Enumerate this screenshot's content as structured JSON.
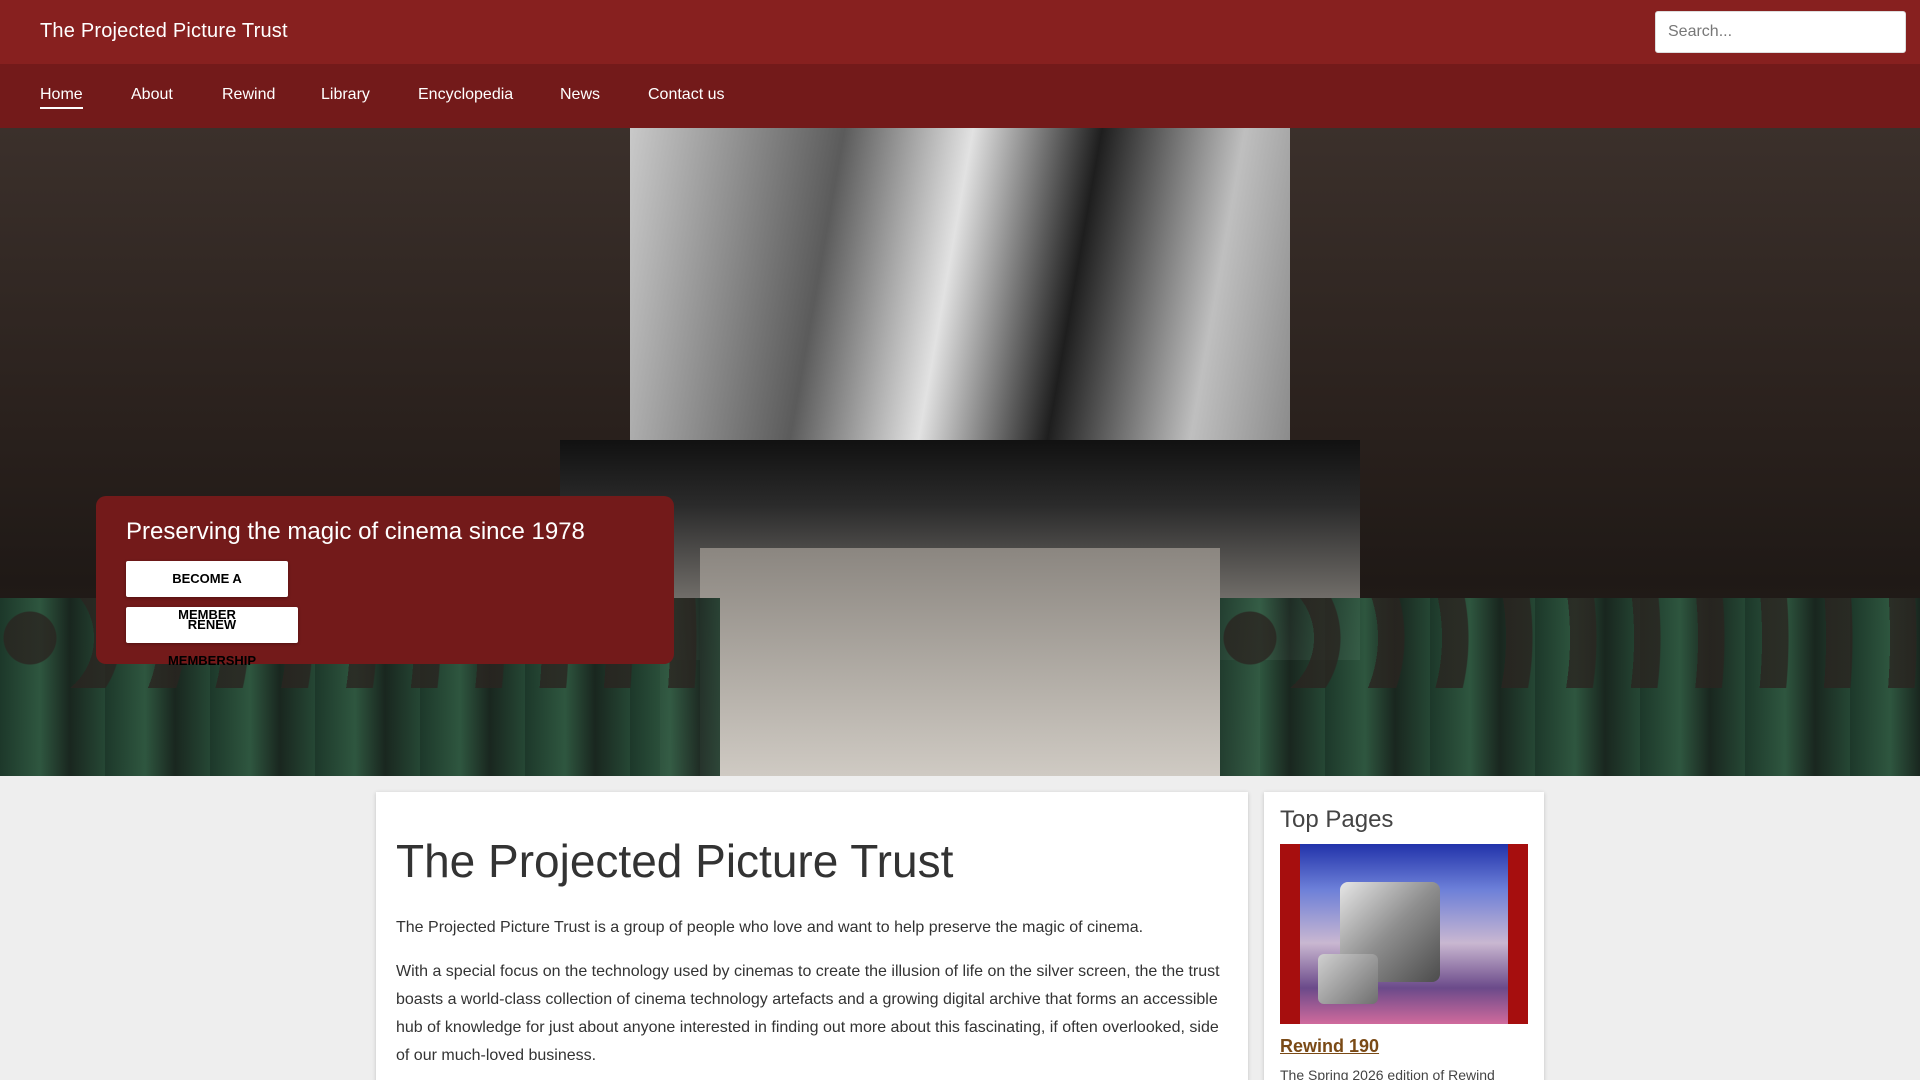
{
  "header": {
    "site_title": "The Projected Picture Trust",
    "search_placeholder": "Search..."
  },
  "nav": {
    "items": [
      {
        "label": "Home",
        "active": true
      },
      {
        "label": "About"
      },
      {
        "label": "Rewind"
      },
      {
        "label": "Library"
      },
      {
        "label": "Encyclopedia"
      },
      {
        "label": "News"
      },
      {
        "label": "Contact us"
      }
    ]
  },
  "hero": {
    "tagline": "Preserving the magic of cinema since 1978",
    "buttons": {
      "member": "BECOME A MEMBER",
      "renew": "RENEW MEMBERSHIP"
    }
  },
  "main": {
    "title": "The Projected Picture Trust",
    "paragraphs": [
      "The Projected Picture Trust is a group of people who love and want to help preserve the magic of cinema.",
      "With a special focus on the technology used by cinemas to create the illusion of life on the silver screen, the the trust boasts a world-class collection of cinema technology artefacts and a growing digital archive that forms an accessible hub of knowledge for just about anyone interested in finding out more about this fascinating, if often overlooked, side of our much-loved business."
    ]
  },
  "sidebar": {
    "title": "Top Pages",
    "item": {
      "link_label": "Rewind 190",
      "description": "The Spring 2026 edition of Rewind"
    }
  },
  "colors": {
    "topbar": "#87201f",
    "navbar": "#731a1a",
    "hero_card": "#731a1a",
    "link": "#7a4a16"
  }
}
